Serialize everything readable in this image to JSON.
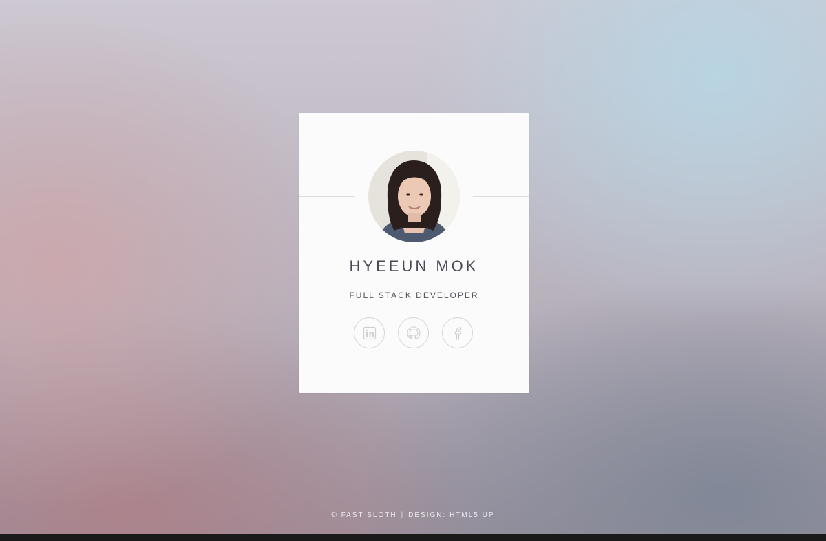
{
  "profile": {
    "name": "HYEEUN MOK",
    "role": "FULL STACK DEVELOPER",
    "avatar_icon": "person-photo"
  },
  "socials": [
    {
      "label": "LinkedIn",
      "icon": "linkedin-icon"
    },
    {
      "label": "GitHub",
      "icon": "github-icon"
    },
    {
      "label": "Facebook",
      "icon": "facebook-icon"
    }
  ],
  "footer": {
    "copyright": "© FAST SLOTH",
    "separator": "|",
    "design": "DESIGN: HTML5 UP"
  },
  "colors": {
    "card_bg": "#fbfbfb",
    "text": "#4a4a55",
    "icon_stroke": "#d6d6d6",
    "bottom_bar": "#1b1a1a"
  }
}
